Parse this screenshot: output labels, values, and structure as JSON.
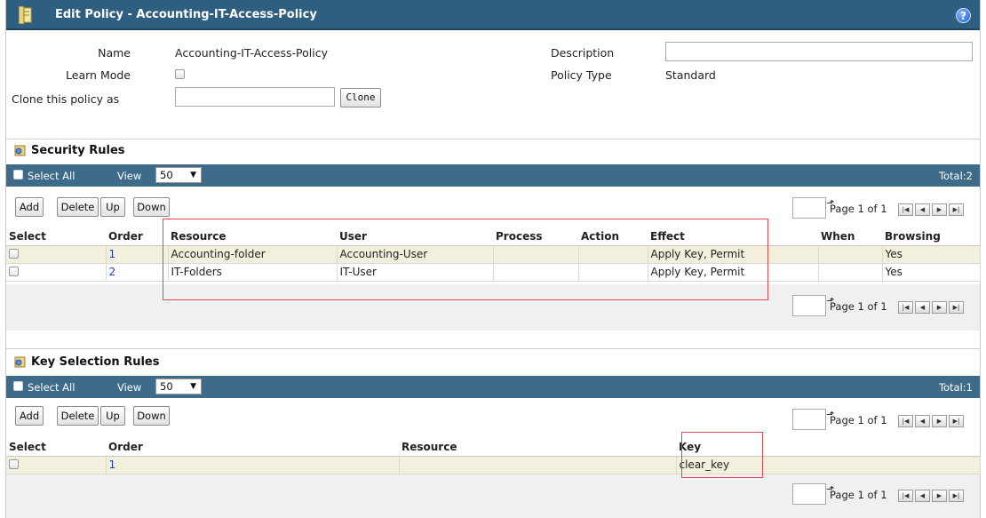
{
  "header": {
    "title": "Edit Policy - Accounting-IT-Access-Policy"
  },
  "form": {
    "name_label": "Name",
    "name_value": "Accounting-IT-Access-Policy",
    "learn_mode_label": "Learn Mode",
    "clone_label": "Clone this policy as",
    "clone_placeholder": "",
    "clone_button": "Clone",
    "description_label": "Description",
    "description_value": "",
    "policy_type_label": "Policy Type",
    "policy_type_value": "Standard"
  },
  "security_rules": {
    "title": "Security Rules",
    "select_all": "Select All",
    "view_label": "View",
    "view_value": "50",
    "total": "Total:2",
    "buttons": {
      "add": "Add",
      "delete": "Delete",
      "up": "Up",
      "down": "Down"
    },
    "pager_text": "Page 1 of 1",
    "columns": [
      "Select",
      "Order",
      "Resource",
      "User",
      "Process",
      "Action",
      "Effect",
      "When",
      "Browsing"
    ],
    "rows": [
      {
        "order": "1",
        "resource": "Accounting-folder",
        "user": "Accounting-User",
        "process": "",
        "action": "",
        "effect": "Apply Key, Permit",
        "when": "",
        "browsing": "Yes"
      },
      {
        "order": "2",
        "resource": "IT-Folders",
        "user": "IT-User",
        "process": "",
        "action": "",
        "effect": "Apply Key, Permit",
        "when": "",
        "browsing": "Yes"
      }
    ]
  },
  "key_rules": {
    "title": "Key Selection Rules",
    "select_all": "Select All",
    "view_label": "View",
    "view_value": "50",
    "total": "Total:1",
    "buttons": {
      "add": "Add",
      "delete": "Delete",
      "up": "Up",
      "down": "Down"
    },
    "pager_text": "Page 1 of 1",
    "columns": [
      "Select",
      "Order",
      "Resource",
      "Key"
    ],
    "rows": [
      {
        "order": "1",
        "resource": "",
        "key": "clear_key"
      }
    ]
  },
  "colors": {
    "titlebar": "#2f5f80",
    "toolbar": "#3e6b8a",
    "highlight_box": "#e0474c",
    "row_odd": "#f2f0dd"
  }
}
